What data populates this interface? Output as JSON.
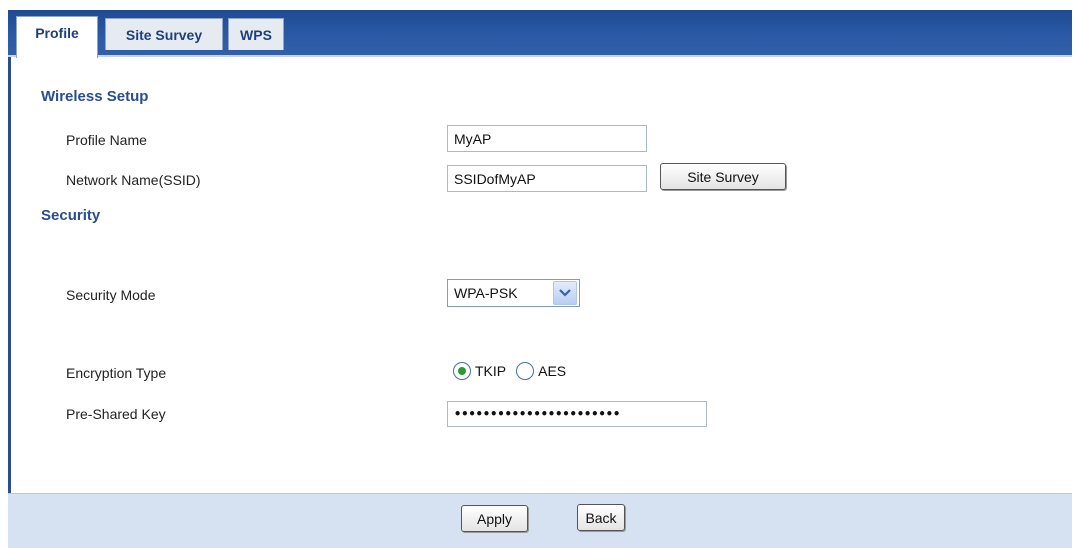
{
  "tabs": [
    {
      "label": "Profile",
      "active": true
    },
    {
      "label": "Site Survey",
      "active": false
    },
    {
      "label": "WPS",
      "active": false
    }
  ],
  "wireless_setup": {
    "title": "Wireless Setup",
    "profile_name_label": "Profile Name",
    "profile_name_value": "MyAP",
    "ssid_label": "Network Name(SSID)",
    "ssid_value": "SSIDofMyAP",
    "site_survey_button": "Site Survey"
  },
  "security": {
    "title": "Security",
    "mode_label": "Security Mode",
    "mode_value": "WPA-PSK",
    "encryption_label": "Encryption Type",
    "encryption_options": [
      {
        "label": "TKIP",
        "selected": true
      },
      {
        "label": "AES",
        "selected": false
      }
    ],
    "psk_label": "Pre-Shared Key",
    "psk_value": "•••••••••••••••••••••••"
  },
  "footer": {
    "apply_label": "Apply",
    "back_label": "Back"
  },
  "colors": {
    "tab_bar": "#2c5aa6",
    "section_title": "#2a4d8f",
    "footer_bg": "#d6e1f1",
    "radio_selected": "#2d9a2d"
  }
}
